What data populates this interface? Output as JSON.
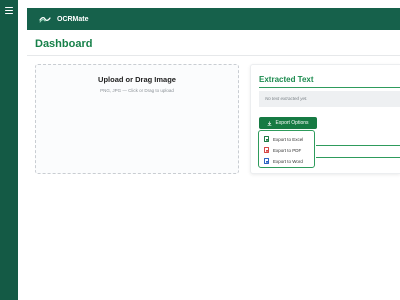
{
  "app": {
    "brand": "OCRMate"
  },
  "page": {
    "title": "Dashboard"
  },
  "upload": {
    "title": "Upload or Drag Image",
    "subtitle": "PNG, JPG — Click or Drag to upload"
  },
  "extracted": {
    "title": "Extracted Text",
    "placeholder": "No text extracted yet."
  },
  "export": {
    "button_label": "Export Options",
    "items": [
      {
        "label": "Export to Excel",
        "icon": "excel-file-icon",
        "color": "#1e7b45"
      },
      {
        "label": "Export to PDF",
        "icon": "pdf-file-icon",
        "color": "#d64545"
      },
      {
        "label": "Export to Word",
        "icon": "word-file-icon",
        "color": "#2b62c2"
      }
    ]
  },
  "colors": {
    "sidebar": "#145a45",
    "topbar": "#16614b",
    "accent": "#168049",
    "button": "#167a43"
  }
}
